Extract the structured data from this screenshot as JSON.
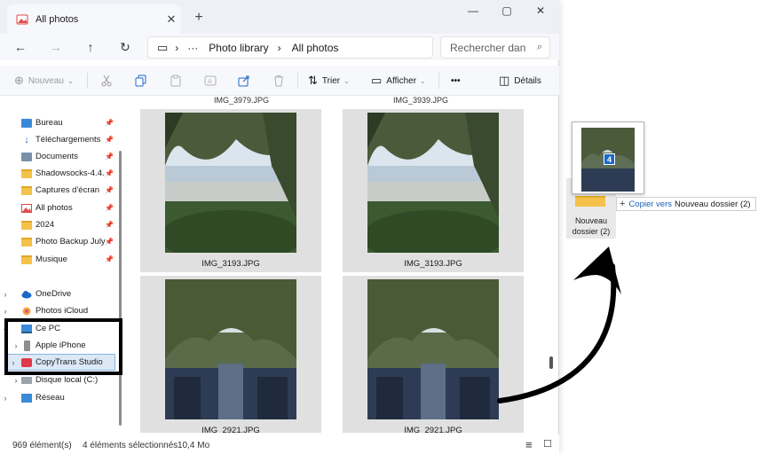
{
  "window": {
    "tab_title": "All photos",
    "tab_close": "✕",
    "new_tab": "+",
    "minimize": "—",
    "maximize": "▢",
    "close": "✕"
  },
  "address": {
    "back": "←",
    "forward": "→",
    "up": "↑",
    "refresh": "↻",
    "monitor": "▭",
    "sep1": "›",
    "ellipsis": "···",
    "crumb1": "Photo library",
    "sep2": "›",
    "crumb2": "All photos",
    "search_placeholder": "Rechercher dan",
    "search_icon": "⌕"
  },
  "toolbar": {
    "new_label": "Nouveau",
    "sort_label": "Trier",
    "view_label": "Afficher",
    "more_label": "•••",
    "details_label": "Détails"
  },
  "sidebar": {
    "items": [
      {
        "label": "Bureau",
        "icon": "desktop-icon"
      },
      {
        "label": "Téléchargements",
        "icon": "download-icon"
      },
      {
        "label": "Documents",
        "icon": "documents-icon"
      },
      {
        "label": "Shadowsocks-4.4.",
        "icon": "folder-icon"
      },
      {
        "label": "Captures d'écran",
        "icon": "folder-icon"
      },
      {
        "label": "All photos",
        "icon": "photos-icon"
      },
      {
        "label": "2024",
        "icon": "folder-icon"
      },
      {
        "label": "Photo Backup July",
        "icon": "folder-icon"
      },
      {
        "label": "Musique",
        "icon": "folder-icon"
      }
    ],
    "onedrive": "OneDrive",
    "icloud": "Photos iCloud",
    "thispc": "Ce PC",
    "iphone": "Apple iPhone",
    "copytrans": "CopyTrans Studio",
    "disk": "Disque local (C:)",
    "network": "Réseau"
  },
  "content": {
    "top_labels": [
      "IMG_3979.JPG",
      "IMG_3939.JPG"
    ],
    "items": [
      {
        "name": "IMG_3193.JPG"
      },
      {
        "name": "IMG_3193.JPG"
      },
      {
        "name": "IMG_2921.JPG"
      },
      {
        "name": "IMG_2921.JPG"
      }
    ]
  },
  "status": {
    "count": "969 élément(s)",
    "selected": "4 éléments sélectionnés",
    "size": "10,4 Mo",
    "list_icon": "≡",
    "tile_icon": "☐"
  },
  "drag": {
    "badge": "4",
    "folder_line1": "Nouveau",
    "folder_line2": "dossier (2)",
    "tip_plus": "+",
    "tip_verb": "Copier vers",
    "tip_target": "Nouveau dossier (2)"
  },
  "colors": {
    "accent": "#1b6ac9",
    "folder": "#f4c24a",
    "selection": "#dce8f6"
  }
}
